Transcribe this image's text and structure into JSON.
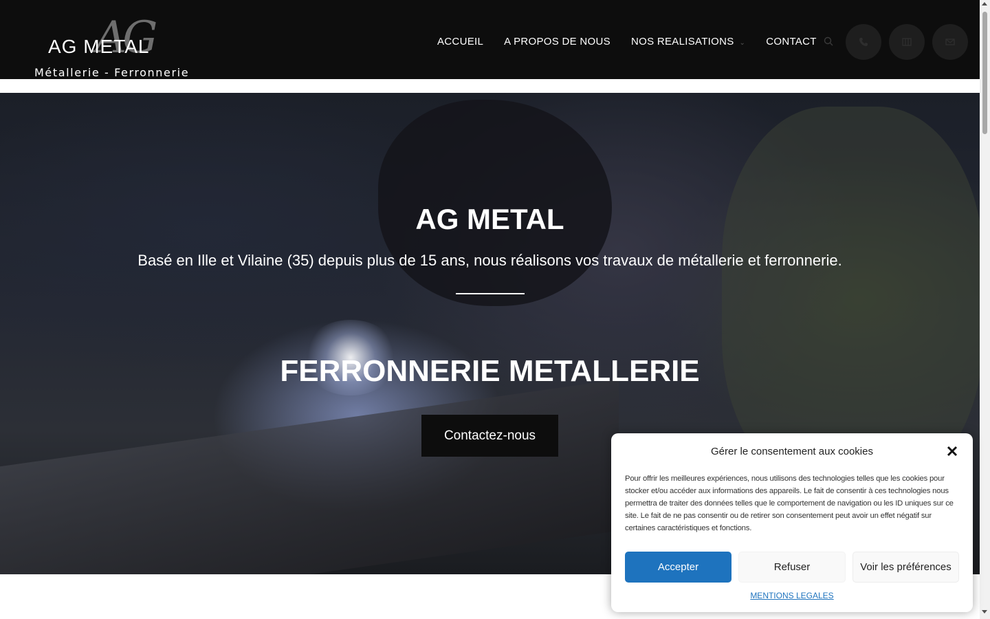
{
  "header": {
    "logo": {
      "script_text": "AG",
      "main_text": "AG METAL",
      "subtitle": "Métallerie - Ferronnerie"
    },
    "nav": [
      {
        "label": "ACCUEIL"
      },
      {
        "label": "A PROPOS DE NOUS"
      },
      {
        "label": "NOS REALISATIONS",
        "has_dropdown": true
      },
      {
        "label": "CONTACT"
      }
    ],
    "icons": [
      "search-icon",
      "phone-icon",
      "map-icon",
      "mail-icon"
    ]
  },
  "hero": {
    "title": "AG METAL",
    "subtitle": "Basé en Ille et Vilaine (35) depuis plus de 15 ans, nous réalisons vos travaux de métallerie et ferronnerie.",
    "heading": "FERRONNERIE METALLERIE",
    "cta_label": "Contactez-nous"
  },
  "cookie_dialog": {
    "title": "Gérer le consentement aux cookies",
    "body": "Pour offrir les meilleures expériences, nous utilisons des technologies telles que les cookies pour stocker et/ou accéder aux informations des appareils. Le fait de consentir à ces technologies nous permettra de traiter des données telles que le comportement de navigation ou les ID uniques sur ce site. Le fait de ne pas consentir ou de retirer son consentement peut avoir un effet négatif sur certaines caractéristiques et fonctions.",
    "accept_label": "Accepter",
    "deny_label": "Refuser",
    "prefs_label": "Voir les préférences",
    "legal_link": "MENTIONS LEGALES"
  },
  "colors": {
    "header_bg": "#0d0d0d",
    "accent_blue": "#1e73be",
    "cta_bg": "#0d0d0d"
  }
}
